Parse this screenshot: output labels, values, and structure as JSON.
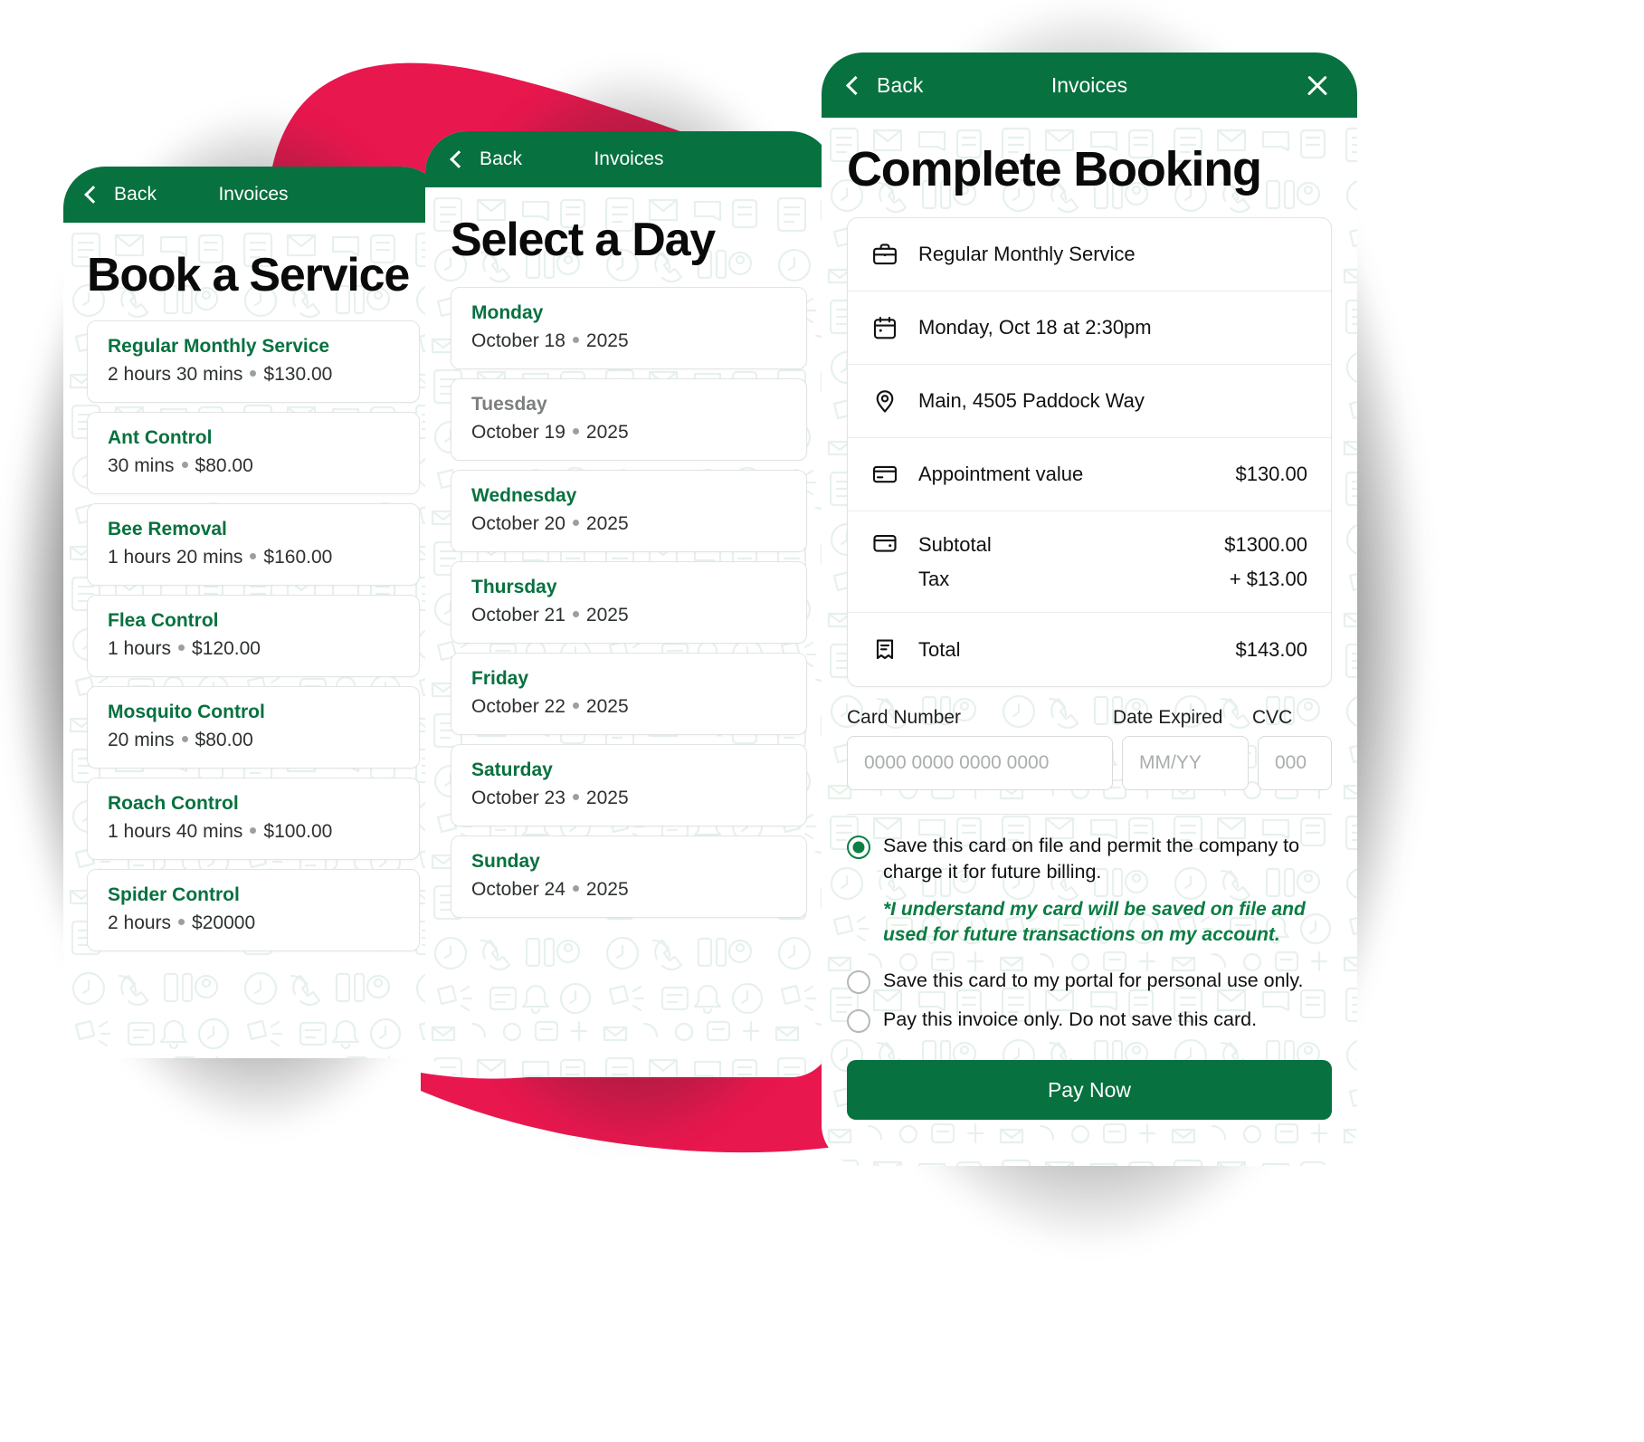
{
  "theme": {
    "green": "#07713f",
    "green_text": "#07713f",
    "pink": "#e8174e",
    "disabled_gray": "#7b7f7d"
  },
  "screens": {
    "book_service": {
      "nav": {
        "back_label": "Back",
        "title": "Invoices",
        "back_icon": "chevron-left-icon"
      },
      "heading": "Book a Service",
      "services": [
        {
          "name": "Regular Monthly Service",
          "duration": "2 hours 30 mins",
          "price": "$130.00"
        },
        {
          "name": "Ant Control",
          "duration": "30 mins",
          "price": "$80.00"
        },
        {
          "name": "Bee Removal",
          "duration": "1 hours 20 mins",
          "price": "$160.00"
        },
        {
          "name": "Flea Control",
          "duration": "1 hours",
          "price": "$120.00"
        },
        {
          "name": "Mosquito Control",
          "duration": "20 mins",
          "price": "$80.00"
        },
        {
          "name": "Roach Control",
          "duration": "1 hours 40 mins",
          "price": "$100.00"
        },
        {
          "name": "Spider Control",
          "duration": "2 hours",
          "price": "$20000"
        }
      ]
    },
    "select_day": {
      "nav": {
        "back_label": "Back",
        "title": "Invoices",
        "back_icon": "chevron-left-icon"
      },
      "heading": "Select a Day",
      "days": [
        {
          "weekday": "Monday",
          "date": "October 18",
          "year": "2025",
          "disabled": false
        },
        {
          "weekday": "Tuesday",
          "date": "October 19",
          "year": "2025",
          "disabled": true
        },
        {
          "weekday": "Wednesday",
          "date": "October 20",
          "year": "2025",
          "disabled": false
        },
        {
          "weekday": "Thursday",
          "date": "October 21",
          "year": "2025",
          "disabled": false
        },
        {
          "weekday": "Friday",
          "date": "October 22",
          "year": "2025",
          "disabled": false
        },
        {
          "weekday": "Saturday",
          "date": "October 23",
          "year": "2025",
          "disabled": false
        },
        {
          "weekday": "Sunday",
          "date": "October 24",
          "year": "2025",
          "disabled": false
        }
      ]
    },
    "complete_booking": {
      "nav": {
        "back_label": "Back",
        "title": "Invoices",
        "back_icon": "chevron-left-icon",
        "close_icon": "close-icon"
      },
      "heading": "Complete Booking",
      "summary": [
        {
          "icon": "briefcase-icon",
          "label": "Regular Monthly Service",
          "value": ""
        },
        {
          "icon": "calendar-icon",
          "label": "Monday, Oct 18 at 2:30pm",
          "value": ""
        },
        {
          "icon": "map-pin-icon",
          "label": "Main, 4505 Paddock Way",
          "value": ""
        },
        {
          "icon": "credit-card-icon",
          "label": "Appointment value",
          "value": "$130.00"
        },
        {
          "icon": "wallet-icon",
          "label": "Subtotal",
          "value": "$1300.00",
          "label2": "Tax",
          "value2": "+ $13.00"
        },
        {
          "icon": "receipt-icon",
          "label": "Total",
          "value": "$143.00"
        }
      ],
      "form": {
        "card_number_label": "Card Number",
        "card_number_placeholder": "0000 0000 0000 0000",
        "card_number_value": "",
        "date_expired_label": "Date Expired",
        "date_expired_placeholder": "MM/YY",
        "date_expired_value": "",
        "cvc_label": "CVC",
        "cvc_placeholder": "000",
        "cvc_value": ""
      },
      "options": [
        {
          "selected": true,
          "text": "Save this card on file and permit the company to charge it for future billing."
        },
        {
          "selected": false,
          "text": "Save this card to my portal for personal use only."
        },
        {
          "selected": false,
          "text": "Pay this invoice only. Do not save this card."
        }
      ],
      "consent_note": "*I understand my card will be saved on file and used for future transactions on my account.",
      "pay_button": "Pay Now"
    }
  }
}
